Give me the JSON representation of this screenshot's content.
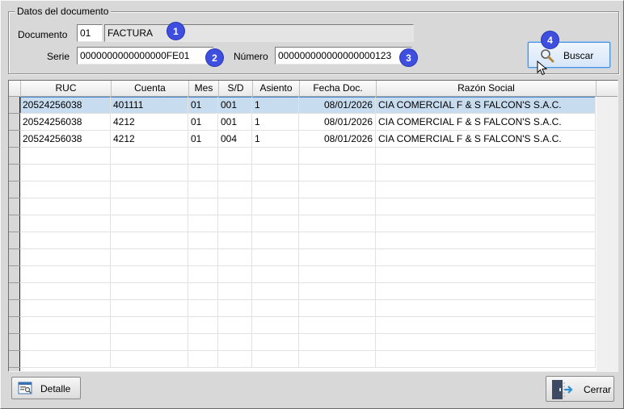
{
  "group": {
    "title": "Datos del documento",
    "documento_label": "Documento",
    "documento_code": "01",
    "documento_name": "FACTURA",
    "serie_label": "Serie",
    "serie_value": "0000000000000000FE01",
    "numero_label": "Número",
    "numero_value": "000000000000000000123"
  },
  "badges": [
    "1",
    "2",
    "3",
    "4"
  ],
  "buttons": {
    "buscar": "Buscar",
    "detalle": "Detalle",
    "cerrar": "Cerrar"
  },
  "table": {
    "columns": [
      "RUC",
      "Cuenta",
      "Mes",
      "S/D",
      "Asiento",
      "Fecha Doc.",
      "Razón Social"
    ],
    "rows": [
      [
        "20524256038",
        "401111",
        "01",
        "001",
        "1",
        "08/01/2026",
        "CIA COMERCIAL F & S FALCON'S S.A.C."
      ],
      [
        "20524256038",
        "4212",
        "01",
        "001",
        "1",
        "08/01/2026",
        "CIA COMERCIAL F & S FALCON'S S.A.C."
      ],
      [
        "20524256038",
        "4212",
        "01",
        "004",
        "1",
        "08/01/2026",
        "CIA COMERCIAL F & S FALCON'S S.A.C."
      ]
    ],
    "selected_row": 0
  },
  "colors": {
    "badge": "#3e4fe0",
    "selected_row": "#c8dcef",
    "selected_border": "#4a8ad0"
  }
}
